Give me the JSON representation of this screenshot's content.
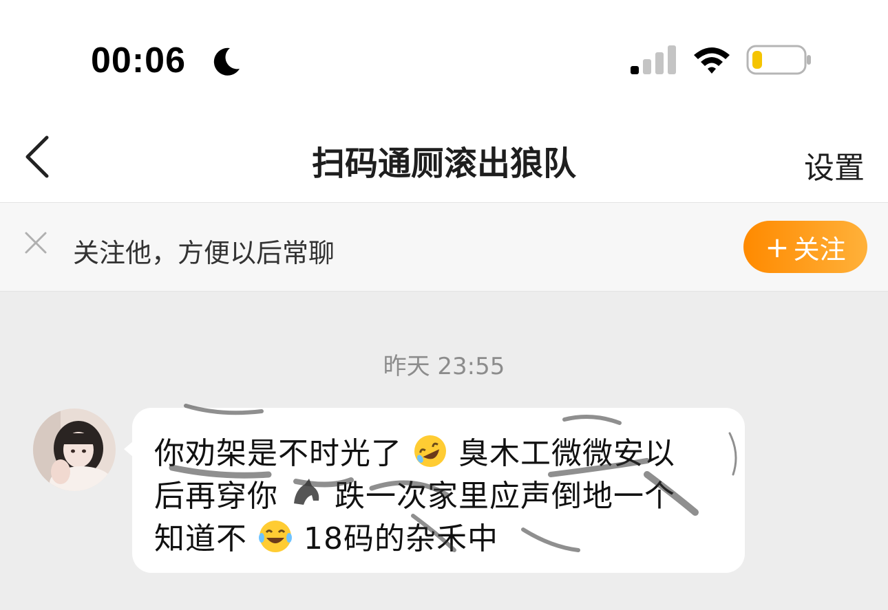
{
  "status_bar": {
    "time": "00:06",
    "icons": [
      "moon-icon",
      "cellular-signal-icon",
      "wifi-icon",
      "battery-icon"
    ],
    "battery_color": "#f5c400"
  },
  "nav": {
    "title": "扫码通厕滚出狼队",
    "settings_label": "设置",
    "back_icon": "chevron-left-icon"
  },
  "follow_banner": {
    "text": "关注他，方便以后常聊",
    "button_plus": "+",
    "button_label": "关注",
    "button_color": "#ff9a1a",
    "close_icon": "close-icon"
  },
  "chat": {
    "timestamp": "昨天 23:55",
    "messages": [
      {
        "sender": "other",
        "lines": [
          {
            "before": "你劝架是不时光了",
            "emoji": "rolling-laughing-emoji",
            "after": "臭木工微微安以"
          },
          {
            "before": "后再穿你",
            "emoji": "horse-emoji",
            "after": "跌一次家里应声倒地一个"
          },
          {
            "before": "知道不",
            "emoji": "crying-laughing-emoji",
            "after": "18码的杂禾中"
          }
        ]
      }
    ]
  }
}
